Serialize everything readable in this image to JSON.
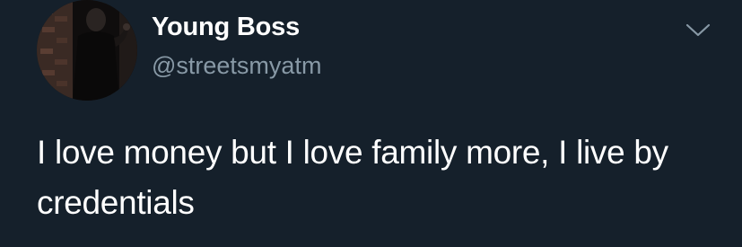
{
  "tweet": {
    "author": {
      "display_name": "Young Boss",
      "handle": "@streetsmyatm"
    },
    "text": "I love money but I love family more, I live by credentials"
  },
  "colors": {
    "background": "#15202b",
    "primary_text": "#ffffff",
    "secondary_text": "#8899a6"
  },
  "icons": {
    "menu": "chevron-down-icon"
  }
}
